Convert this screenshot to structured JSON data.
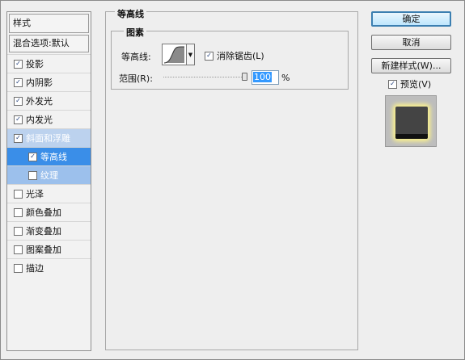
{
  "sidebar": {
    "header": "样式",
    "blending": "混合选项:默认",
    "items": [
      {
        "label": "投影",
        "checked": true
      },
      {
        "label": "内阴影",
        "checked": true
      },
      {
        "label": "外发光",
        "checked": true
      },
      {
        "label": "内发光",
        "checked": true
      },
      {
        "label": "斜面和浮雕",
        "checked": true
      },
      {
        "label": "等高线",
        "checked": true
      },
      {
        "label": "纹理",
        "checked": false
      },
      {
        "label": "光泽",
        "checked": false
      },
      {
        "label": "颜色叠加",
        "checked": false
      },
      {
        "label": "渐变叠加",
        "checked": false
      },
      {
        "label": "图案叠加",
        "checked": false
      },
      {
        "label": "描边",
        "checked": false
      }
    ]
  },
  "panel": {
    "title": "等高线",
    "group_title": "图素",
    "contour_label": "等高线:",
    "antialias_label": "消除锯齿(L)",
    "antialias_checked": true,
    "range_label": "范围(R):",
    "range_value": "100",
    "range_fraction": 1.0,
    "range_unit": "%"
  },
  "buttons": {
    "ok": "确定",
    "cancel": "取消",
    "new_style": "新建样式(W)...",
    "preview_label": "预览(V)",
    "preview_checked": true
  },
  "icons": {
    "contour_picker": "contour-curve-icon",
    "dropdown": "chevron-down-icon",
    "preview_swatch": "style-preview-swatch"
  },
  "colors": {
    "selection": "#3a8ee8",
    "selection_light": "#9cc0ec",
    "default_button_border": "#3c7fb1",
    "preview_glow": "#fff58a"
  }
}
